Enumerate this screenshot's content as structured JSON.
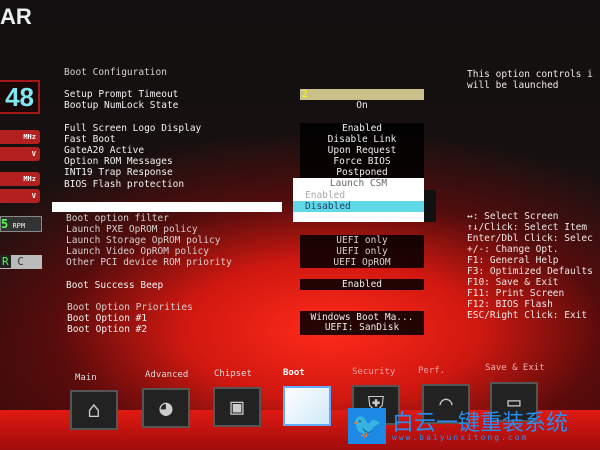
{
  "brand": {
    "logo_text": "AR",
    "clock": "48",
    "freq_unit": "MHz",
    "volt_unit": "V",
    "fan_unit": "RPM",
    "fan_digit": "5",
    "temp_unit": "C",
    "temp_digit": "R"
  },
  "section_title": "Boot Configuration",
  "settings": [
    {
      "label": "Setup Prompt Timeout",
      "value": "2"
    },
    {
      "label": "Bootup NumLock State",
      "value": "On"
    },
    {
      "label": "Full Screen Logo Display",
      "value": "Enabled"
    },
    {
      "label": "Fast Boot",
      "value": "Disable Link"
    },
    {
      "label": "GateA20 Active",
      "value": "Upon Request"
    },
    {
      "label": "Option ROM Messages",
      "value": "Force BIOS"
    },
    {
      "label": "INT19 Trap Response",
      "value": "Postponed"
    },
    {
      "label": "BIOS Flash protection",
      "value": ""
    },
    {
      "label": "Boot option filter",
      "value": ""
    },
    {
      "label": "Launch PXE OpROM policy",
      "value": ""
    },
    {
      "label": "Launch Storage OpROM policy",
      "value": "UEFI only"
    },
    {
      "label": "Launch Video OpROM policy",
      "value": "UEFI only"
    },
    {
      "label": "Other PCI device ROM priority",
      "value": "UEFI OpROM"
    },
    {
      "label": "Boot Success Beep",
      "value": "Enabled"
    }
  ],
  "priorities": {
    "title": "Boot Option Priorities",
    "items": [
      {
        "label": "Boot Option #1",
        "value": "Windows Boot Ma..."
      },
      {
        "label": "Boot Option #2",
        "value": "UEFI: SanDisk"
      }
    ]
  },
  "popup": {
    "title": "Launch CSM",
    "options": [
      "Enabled",
      "Disabled"
    ],
    "selected": "Disabled"
  },
  "help_text": [
    "This option controls i",
    "will be launched"
  ],
  "keys": [
    "↔: Select Screen",
    "↑↓/Click: Select Item",
    "Enter/Dbl Click: Selec",
    "+/-: Change Opt.",
    "F1: General Help",
    "F3: Optimized Defaults",
    "F10: Save & Exit",
    "F11: Print Screen",
    "F12: BIOS Flash",
    "ESC/Right Click: Exit"
  ],
  "tabs": [
    {
      "label": "Main",
      "icon": "house-icon"
    },
    {
      "label": "Advanced",
      "icon": "joystick-icon"
    },
    {
      "label": "Chipset",
      "icon": "chip-icon"
    },
    {
      "label": "Boot",
      "icon": "drive-icon",
      "active": true
    },
    {
      "label": "Security",
      "icon": "shield-icon"
    },
    {
      "label": "Perf.",
      "icon": "gauge-icon"
    },
    {
      "label": "Save & Exit",
      "icon": "folder-icon"
    }
  ],
  "watermark": {
    "text": "白云一键重装系统",
    "url": "www.baiyunxitong.com"
  },
  "colors": {
    "accent": "#e02010",
    "highlight": "#5fd8e8",
    "timeout_bg": "#c9c08a"
  }
}
